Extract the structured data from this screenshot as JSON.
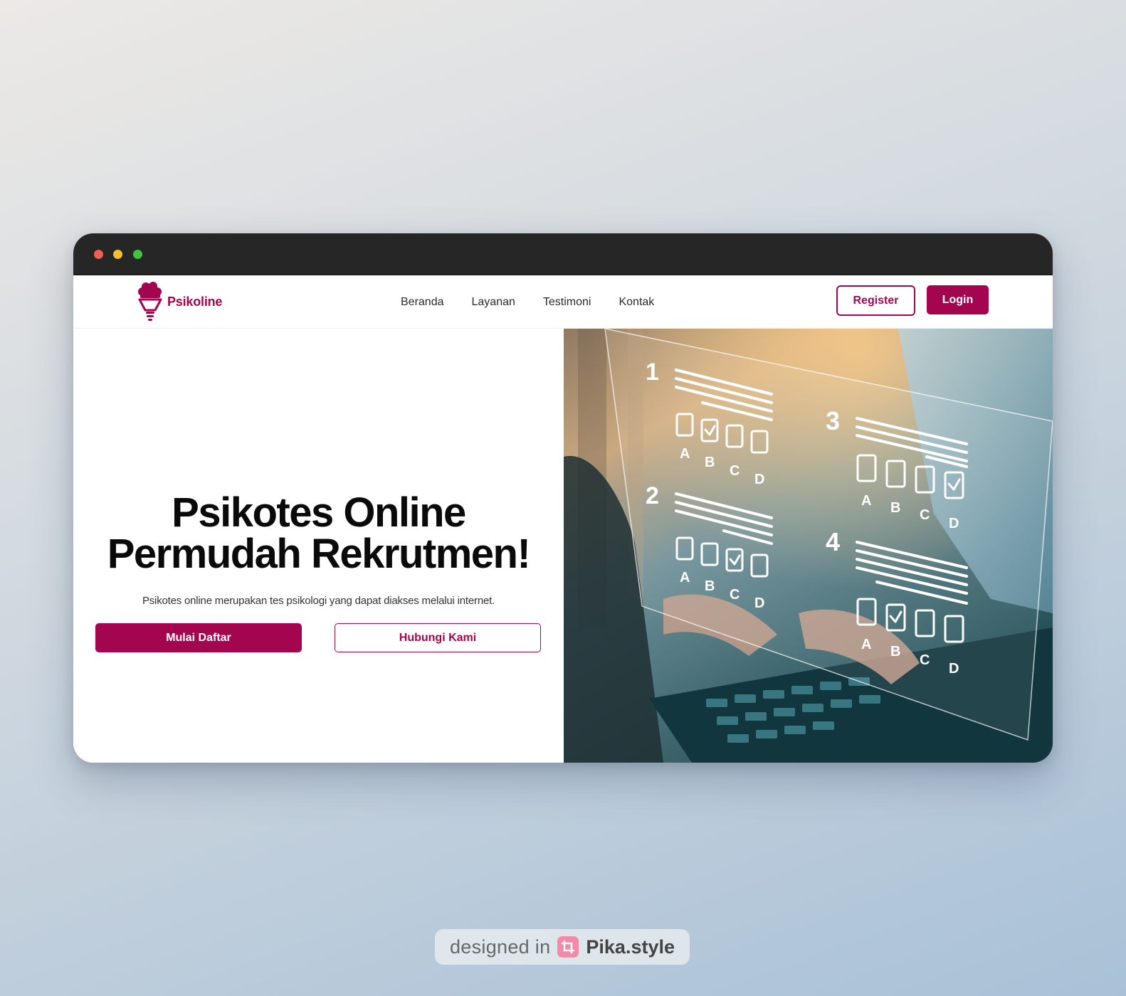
{
  "window": {
    "controls": [
      "close",
      "minimize",
      "maximize"
    ]
  },
  "navbar": {
    "brand": "Psikoline",
    "links": [
      "Beranda",
      "Layanan",
      "Testimoni",
      "Kontak"
    ],
    "register_label": "Register",
    "login_label": "Login"
  },
  "hero": {
    "title_line1": "Psikotes Online",
    "title_line2": "Permudah Rekrutmen!",
    "subtitle": "Psikotes online merupakan tes psikologi yang dapat diakses melalui internet.",
    "primary_label": "Mulai Daftar",
    "secondary_label": "Hubungi Kami",
    "image": {
      "questions": [
        {
          "number": "1",
          "options": [
            "A",
            "B",
            "C",
            "D"
          ],
          "checked": "B"
        },
        {
          "number": "2",
          "options": [
            "A",
            "B",
            "C",
            "D"
          ],
          "checked": "C"
        },
        {
          "number": "3",
          "options": [
            "A",
            "B",
            "C",
            "D"
          ],
          "checked": "D"
        },
        {
          "number": "4",
          "options": [
            "A",
            "B",
            "C",
            "D"
          ],
          "checked": "B"
        }
      ]
    }
  },
  "badge": {
    "prefix": "designed in",
    "brand": "Pika.style"
  },
  "colors": {
    "accent": "#a3064f",
    "titlebar": "#262626"
  }
}
